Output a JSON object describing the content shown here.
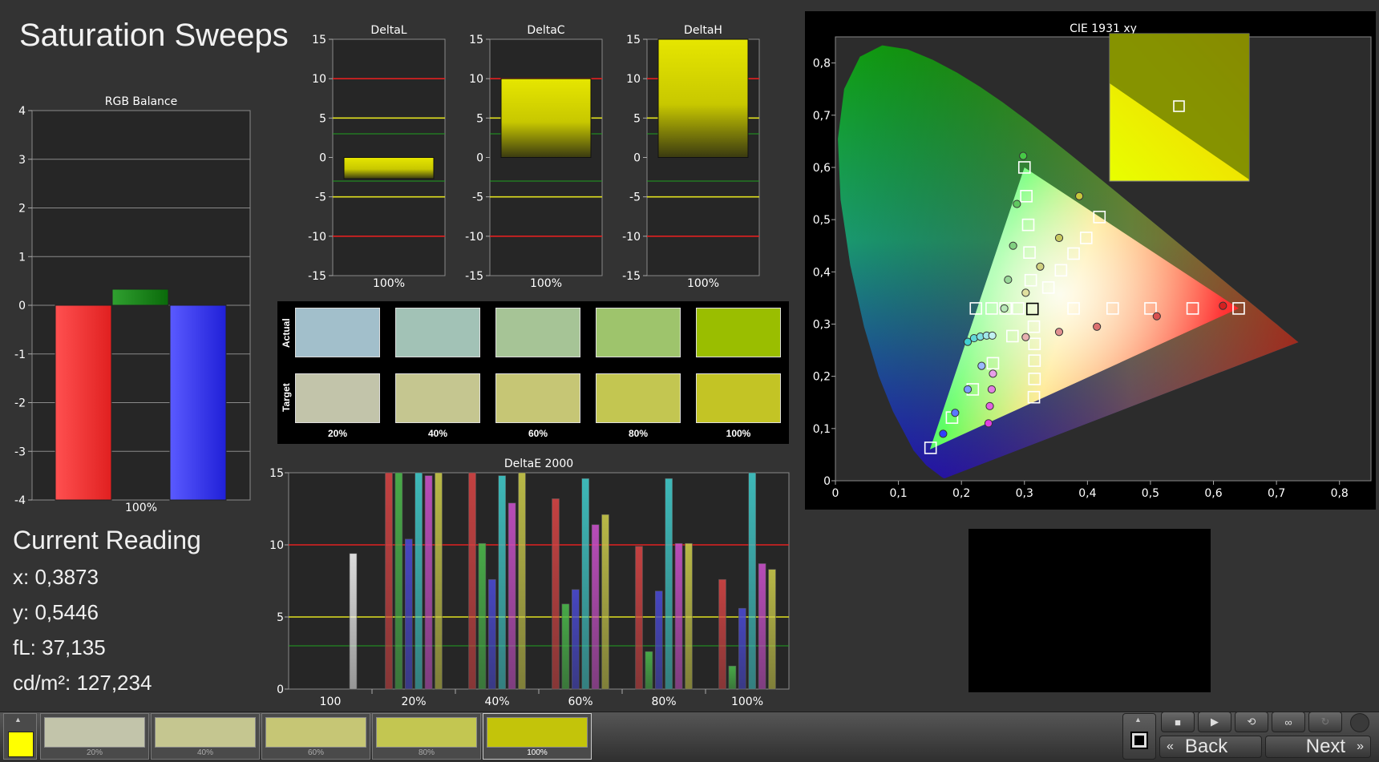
{
  "page_title": "Saturation Sweeps",
  "current_reading": {
    "heading": "Current Reading",
    "x": "x: 0,3873",
    "y": "y: 0,5446",
    "fl": "fL: 37,135",
    "cdm2": "cd/m²: 127,234"
  },
  "swatches": {
    "row_labels": [
      "Actual",
      "Target"
    ],
    "columns": [
      "20%",
      "40%",
      "60%",
      "80%",
      "100%"
    ],
    "actual_colors": [
      "#a2bfcb",
      "#a2c2b6",
      "#a6c496",
      "#9ec46c",
      "#9abe00"
    ],
    "target_colors": [
      "#c2c4aa",
      "#c5c690",
      "#c6c675",
      "#c3c651",
      "#c3c425"
    ]
  },
  "bottom_bar": {
    "current_color": "#ffff00",
    "swatches": [
      {
        "label": "20%",
        "color": "#c2c4aa"
      },
      {
        "label": "40%",
        "color": "#c5c690"
      },
      {
        "label": "60%",
        "color": "#c6c675"
      },
      {
        "label": "80%",
        "color": "#c3c651"
      },
      {
        "label": "100%",
        "color": "#c3c40a"
      }
    ],
    "controls": [
      "stop-icon",
      "play-icon",
      "loop-icon",
      "infinity-icon",
      "refresh-icon"
    ],
    "back_label": "Back",
    "next_label": "Next"
  },
  "chart_data": [
    {
      "id": "rgb_balance",
      "type": "bar",
      "title": "RGB Balance",
      "categories": [
        "100%"
      ],
      "series": [
        {
          "color": "red",
          "values": [
            -4.0
          ]
        },
        {
          "color": "green",
          "values": [
            0.33
          ]
        },
        {
          "color": "blue",
          "values": [
            -4.0
          ]
        }
      ],
      "ylim": [
        -4,
        4
      ],
      "yticks": [
        "4",
        "3",
        "2",
        "1",
        "0",
        "-1",
        "-2",
        "-3",
        "-4"
      ],
      "grid": true
    },
    {
      "id": "delta_l",
      "type": "bar",
      "title": "DeltaL",
      "categories": [
        "100%"
      ],
      "values": [
        -2.7
      ],
      "ylim": [
        -15,
        15
      ],
      "yticks": [
        "15",
        "10",
        "5",
        "0",
        "-5",
        "-10",
        "-15"
      ],
      "reference_lines": [
        10,
        5,
        3,
        -3,
        -5,
        -10
      ]
    },
    {
      "id": "delta_c",
      "type": "bar",
      "title": "DeltaC",
      "categories": [
        "100%"
      ],
      "values": [
        10.0
      ],
      "ylim": [
        -15,
        15
      ],
      "yticks": [
        "15",
        "10",
        "5",
        "0",
        "-5",
        "-10",
        "-15"
      ],
      "reference_lines": [
        10,
        5,
        3,
        -3,
        -5,
        -10
      ]
    },
    {
      "id": "delta_h",
      "type": "bar",
      "title": "DeltaH",
      "categories": [
        "100%"
      ],
      "values": [
        15.0
      ],
      "ylim": [
        -15,
        15
      ],
      "yticks": [
        "15",
        "10",
        "5",
        "0",
        "-5",
        "-10",
        "-15"
      ],
      "reference_lines": [
        10,
        5,
        3,
        -3,
        -5,
        -10
      ]
    },
    {
      "id": "delta_e_2000",
      "type": "bar",
      "title": "DeltaE 2000",
      "categories": [
        "100",
        "20%",
        "40%",
        "60%",
        "80%",
        "100%"
      ],
      "series_colors": [
        "#d44444",
        "#4bb84b",
        "#4a4ad2",
        "#40c8c8",
        "#c850c8",
        "#c8c84a"
      ],
      "groups": [
        {
          "category": "100",
          "bars": [
            {
              "color": "#f0f0f0",
              "value": 9.4
            }
          ]
        },
        {
          "category": "20%",
          "bars": [
            15,
            15,
            10.4,
            15,
            14.8,
            15
          ]
        },
        {
          "category": "40%",
          "bars": [
            15,
            10.1,
            7.6,
            14.8,
            12.9,
            15
          ]
        },
        {
          "category": "60%",
          "bars": [
            13.2,
            5.9,
            6.9,
            14.6,
            11.4,
            12.1
          ]
        },
        {
          "category": "80%",
          "bars": [
            9.9,
            2.6,
            6.8,
            14.6,
            10.1,
            10.1
          ]
        },
        {
          "category": "100%",
          "bars": [
            7.6,
            1.6,
            5.6,
            15,
            8.7,
            8.3
          ]
        }
      ],
      "ylim": [
        0,
        15
      ],
      "yticks": [
        "15",
        "10",
        "5",
        "0"
      ],
      "reference_lines": [
        10,
        5,
        3
      ]
    },
    {
      "id": "cie_1931_xy",
      "type": "scatter",
      "title": "CIE 1931 xy",
      "xlim": [
        0,
        0.85
      ],
      "ylim": [
        0,
        0.85
      ],
      "xticks": [
        "0",
        "0,1",
        "0,2",
        "0,3",
        "0,4",
        "0,5",
        "0,6",
        "0,7",
        "0,8"
      ],
      "yticks": [
        "0",
        "0,1",
        "0,2",
        "0,3",
        "0,4",
        "0,5",
        "0,6",
        "0,7",
        "0,8"
      ],
      "gamut": {
        "red": [
          0.64,
          0.33
        ],
        "green": [
          0.3,
          0.6
        ],
        "blue": [
          0.15,
          0.06
        ],
        "white": [
          0.3127,
          0.329
        ]
      },
      "targets": [
        [
          0.151,
          0.063
        ],
        [
          0.185,
          0.121
        ],
        [
          0.218,
          0.175
        ],
        [
          0.25,
          0.225
        ],
        [
          0.281,
          0.277
        ],
        [
          0.3,
          0.6
        ],
        [
          0.303,
          0.545
        ],
        [
          0.306,
          0.49
        ],
        [
          0.308,
          0.437
        ],
        [
          0.31,
          0.384
        ],
        [
          0.419,
          0.505
        ],
        [
          0.398,
          0.465
        ],
        [
          0.378,
          0.435
        ],
        [
          0.358,
          0.403
        ],
        [
          0.338,
          0.37
        ],
        [
          0.64,
          0.33
        ],
        [
          0.567,
          0.33
        ],
        [
          0.5,
          0.33
        ],
        [
          0.44,
          0.33
        ],
        [
          0.378,
          0.33
        ],
        [
          0.315,
          0.16
        ],
        [
          0.316,
          0.195
        ],
        [
          0.316,
          0.23
        ],
        [
          0.316,
          0.262
        ],
        [
          0.315,
          0.295
        ],
        [
          0.223,
          0.33
        ],
        [
          0.248,
          0.33
        ],
        [
          0.27,
          0.33
        ],
        [
          0.29,
          0.33
        ],
        [
          0.3127,
          0.329
        ]
      ],
      "measured": [
        {
          "x": 0.171,
          "y": 0.09,
          "c": "#3040ff"
        },
        {
          "x": 0.19,
          "y": 0.13,
          "c": "#5a78ff"
        },
        {
          "x": 0.21,
          "y": 0.175,
          "c": "#7a9cff"
        },
        {
          "x": 0.232,
          "y": 0.22,
          "c": "#9ab8ff"
        },
        {
          "x": 0.298,
          "y": 0.622,
          "c": "#46c846"
        },
        {
          "x": 0.288,
          "y": 0.53,
          "c": "#60c860"
        },
        {
          "x": 0.282,
          "y": 0.45,
          "c": "#80d080"
        },
        {
          "x": 0.274,
          "y": 0.385,
          "c": "#9ad89a"
        },
        {
          "x": 0.268,
          "y": 0.33,
          "c": "#b8e8b8"
        },
        {
          "x": 0.387,
          "y": 0.545,
          "c": "#c8c83c"
        },
        {
          "x": 0.355,
          "y": 0.465,
          "c": "#c8c860"
        },
        {
          "x": 0.325,
          "y": 0.41,
          "c": "#d0d080"
        },
        {
          "x": 0.302,
          "y": 0.36,
          "c": "#e0e0a0"
        },
        {
          "x": 0.615,
          "y": 0.335,
          "c": "#d42020"
        },
        {
          "x": 0.51,
          "y": 0.315,
          "c": "#d85050"
        },
        {
          "x": 0.415,
          "y": 0.295,
          "c": "#dc7070"
        },
        {
          "x": 0.355,
          "y": 0.285,
          "c": "#e09090"
        },
        {
          "x": 0.302,
          "y": 0.275,
          "c": "#e6b0b0"
        },
        {
          "x": 0.243,
          "y": 0.11,
          "c": "#e040e0"
        },
        {
          "x": 0.245,
          "y": 0.143,
          "c": "#e060e0"
        },
        {
          "x": 0.248,
          "y": 0.175,
          "c": "#e080e0"
        },
        {
          "x": 0.25,
          "y": 0.205,
          "c": "#e8a0e8"
        },
        {
          "x": 0.21,
          "y": 0.266,
          "c": "#40d0d0"
        },
        {
          "x": 0.22,
          "y": 0.273,
          "c": "#60d8d8"
        },
        {
          "x": 0.23,
          "y": 0.276,
          "c": "#80e0e0"
        },
        {
          "x": 0.24,
          "y": 0.278,
          "c": "#a0e8e8"
        },
        {
          "x": 0.249,
          "y": 0.278,
          "c": "#c0f0f0"
        }
      ]
    }
  ]
}
